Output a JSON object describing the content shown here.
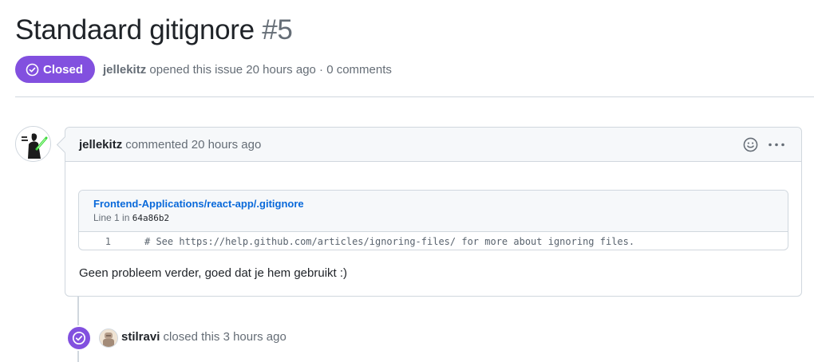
{
  "issue": {
    "title": "Standaard gitignore",
    "number": "#5",
    "state": "Closed",
    "author": "jellekitz",
    "opened_text": "opened this issue 20 hours ago · 0 comments"
  },
  "comment": {
    "author": "jellekitz",
    "action": "commented 20 hours ago",
    "snippet": {
      "path": "Frontend-Applications/react-app/.gitignore",
      "line_prefix": "Line 1 in",
      "commit": "64a86b2",
      "line_number": "1",
      "code": "# See https://help.github.com/articles/ignoring-files/ for more about ignoring files."
    },
    "body": "Geen probleem verder, goed dat je hem gebruikt :)"
  },
  "event": {
    "actor": "stilravi",
    "text": "closed this 3 hours ago"
  },
  "colors": {
    "closed_purple": "#8250df",
    "link_blue": "#0969da",
    "border": "#d0d7de",
    "muted": "#656d76"
  },
  "icons": [
    "check-circle-icon",
    "smiley-icon",
    "kebab-horizontal-icon"
  ]
}
